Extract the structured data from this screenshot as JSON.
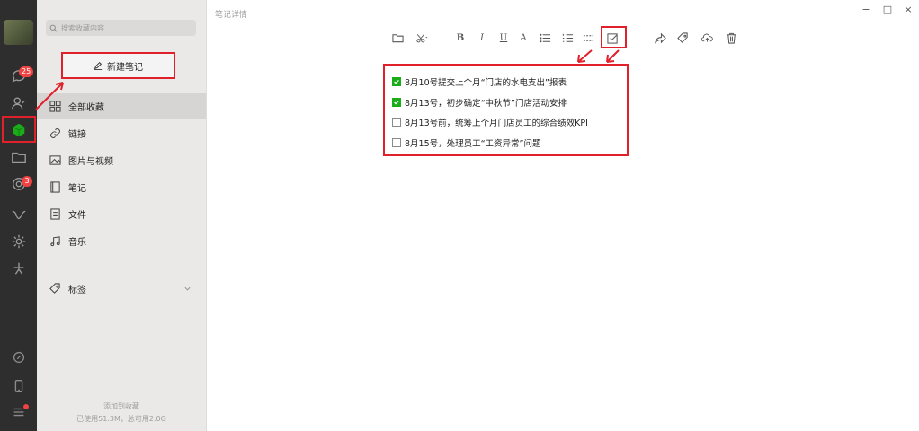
{
  "window": {
    "title": "笔记详情",
    "minimize": "−",
    "maximize": "□",
    "close": "×"
  },
  "rail": {
    "chat_badge": "25",
    "settings_badge": "3",
    "icons": [
      "chat-icon",
      "contacts-icon",
      "favorites-icon",
      "folder-icon",
      "moments-icon",
      "mini-program-icon",
      "settings-icon",
      "star-icon",
      "link-icon",
      "phone-icon",
      "menu-icon"
    ]
  },
  "sidebar": {
    "search_placeholder": "搜索收藏内容",
    "new_note": "新建笔记",
    "items": [
      {
        "label": "全部收藏",
        "icon": "grid-icon"
      },
      {
        "label": "链接",
        "icon": "link-icon"
      },
      {
        "label": "图片与视频",
        "icon": "image-icon"
      },
      {
        "label": "笔记",
        "icon": "note-icon"
      },
      {
        "label": "文件",
        "icon": "file-icon"
      },
      {
        "label": "音乐",
        "icon": "music-icon"
      }
    ],
    "tags_label": "标签",
    "footer_add": "添加到收藏",
    "footer_usage": "已使用51.3M，总可用2.0G"
  },
  "toolbar": {
    "bold": "B",
    "italic": "I",
    "underline": "U",
    "fontsize": "A"
  },
  "tasks": [
    {
      "text": "8月10号提交上个月“门店的水电支出”报表",
      "checked": true
    },
    {
      "text": "8月13号，初步确定“中秋节”门店活动安排",
      "checked": true
    },
    {
      "text": "8月13号前，统筹上个月门店员工的综合绩效KPI",
      "checked": false
    },
    {
      "text": "8月15号，处理员工“工资异常”问题",
      "checked": false
    }
  ],
  "colors": {
    "accent": "#1aad19",
    "annotation": "#e0202b",
    "rail": "#2e2e2e",
    "sidebar": "#ebe9e8"
  }
}
